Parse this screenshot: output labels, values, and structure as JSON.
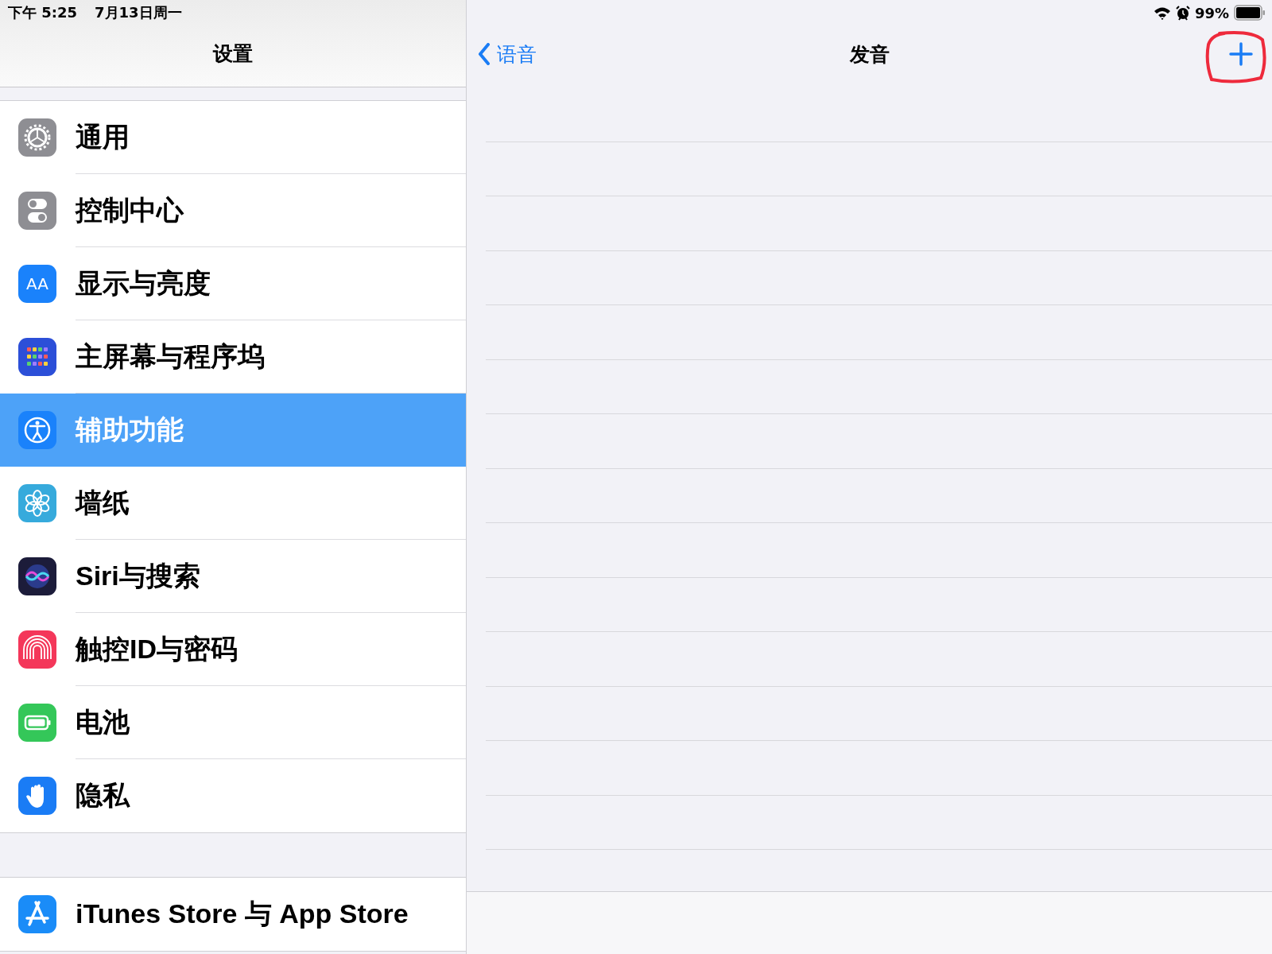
{
  "status_bar": {
    "time": "下午 5:25",
    "date": "7月13日周一",
    "battery": "99%"
  },
  "sidebar": {
    "title": "设置",
    "groups": [
      {
        "items": [
          {
            "label": "通用",
            "color": "#8e8e93",
            "selected": false
          },
          {
            "label": "控制中心",
            "color": "#8e8e93",
            "selected": false
          },
          {
            "label": "显示与亮度",
            "color": "#1a82fb",
            "icon_text": "AA",
            "selected": false
          },
          {
            "label": "主屏幕与程序坞",
            "color": "#2c4fd8",
            "selected": false
          },
          {
            "label": "辅助功能",
            "color": "#1a82fb",
            "selected": true
          },
          {
            "label": "墙纸",
            "color": "#36aadc",
            "selected": false
          },
          {
            "label": "Siri与搜索",
            "color": "#1c1c3a",
            "selected": false
          },
          {
            "label": "触控ID与密码",
            "color": "#f4375a",
            "selected": false
          },
          {
            "label": "电池",
            "color": "#34c759",
            "selected": false
          },
          {
            "label": "隐私",
            "color": "#1a7cf5",
            "selected": false
          }
        ]
      },
      {
        "items": [
          {
            "label": "iTunes Store 与 App Store",
            "color": "#1a8cf8",
            "selected": false
          }
        ]
      }
    ]
  },
  "detail": {
    "back": "语音",
    "title": "发音"
  }
}
